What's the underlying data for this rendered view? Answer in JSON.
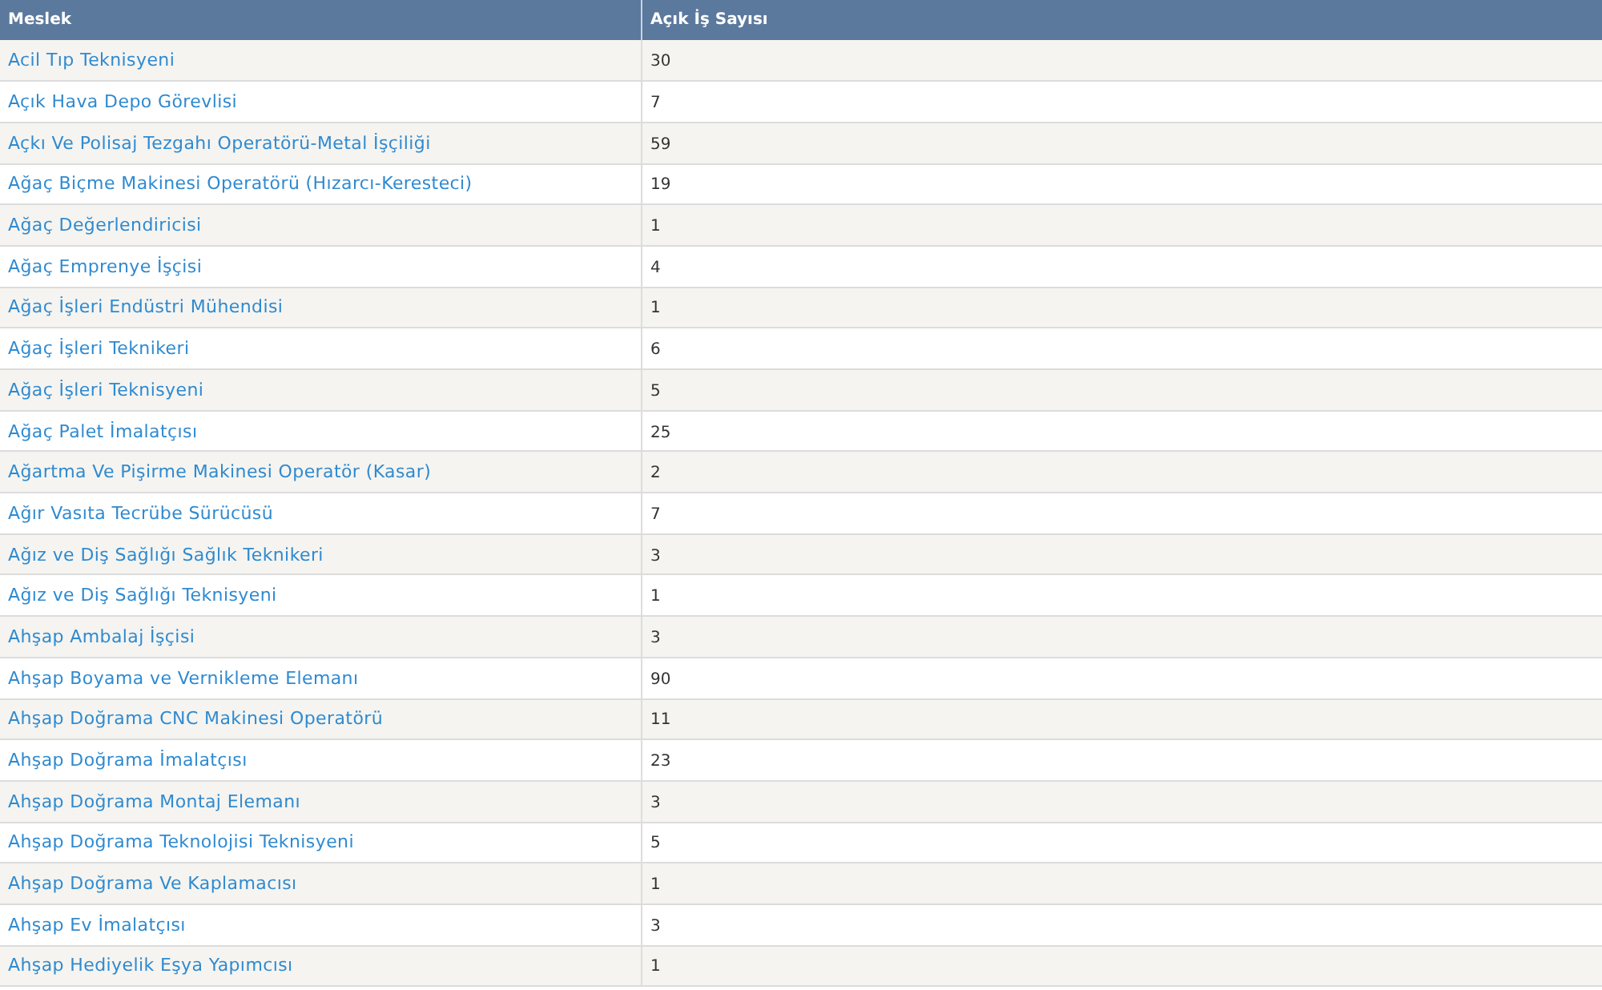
{
  "table": {
    "columns": [
      "Meslek",
      "Açık İş Sayısı"
    ],
    "rows": [
      {
        "occupation": "Acil Tıp Teknisyeni",
        "count": "30"
      },
      {
        "occupation": "Açık Hava Depo Görevlisi",
        "count": "7"
      },
      {
        "occupation": "Açkı Ve Polisaj Tezgahı Operatörü-Metal İşçiliği",
        "count": "59"
      },
      {
        "occupation": "Ağaç Biçme Makinesi Operatörü (Hızarcı-Keresteci)",
        "count": "19"
      },
      {
        "occupation": "Ağaç Değerlendiricisi",
        "count": "1"
      },
      {
        "occupation": "Ağaç Emprenye İşçisi",
        "count": "4"
      },
      {
        "occupation": "Ağaç İşleri Endüstri Mühendisi",
        "count": "1"
      },
      {
        "occupation": "Ağaç İşleri Teknikeri",
        "count": "6"
      },
      {
        "occupation": "Ağaç İşleri Teknisyeni",
        "count": "5"
      },
      {
        "occupation": "Ağaç Palet İmalatçısı",
        "count": "25"
      },
      {
        "occupation": "Ağartma Ve Pişirme Makinesi Operatör (Kasar)",
        "count": "2"
      },
      {
        "occupation": "Ağır Vasıta Tecrübe Sürücüsü",
        "count": "7"
      },
      {
        "occupation": "Ağız ve Diş Sağlığı Sağlık Teknikeri",
        "count": "3"
      },
      {
        "occupation": "Ağız ve Diş Sağlığı Teknisyeni",
        "count": "1"
      },
      {
        "occupation": "Ahşap Ambalaj İşçisi",
        "count": "3"
      },
      {
        "occupation": "Ahşap Boyama ve Vernikleme Elemanı",
        "count": "90"
      },
      {
        "occupation": "Ahşap Doğrama CNC Makinesi Operatörü",
        "count": "11"
      },
      {
        "occupation": "Ahşap Doğrama İmalatçısı",
        "count": "23"
      },
      {
        "occupation": "Ahşap Doğrama Montaj Elemanı",
        "count": "3"
      },
      {
        "occupation": "Ahşap Doğrama Teknolojisi Teknisyeni",
        "count": "5"
      },
      {
        "occupation": "Ahşap Doğrama Ve Kaplamacısı",
        "count": "1"
      },
      {
        "occupation": "Ahşap Ev İmalatçısı",
        "count": "3"
      },
      {
        "occupation": "Ahşap Hediyelik Eşya Yapımcısı",
        "count": "1"
      }
    ]
  }
}
